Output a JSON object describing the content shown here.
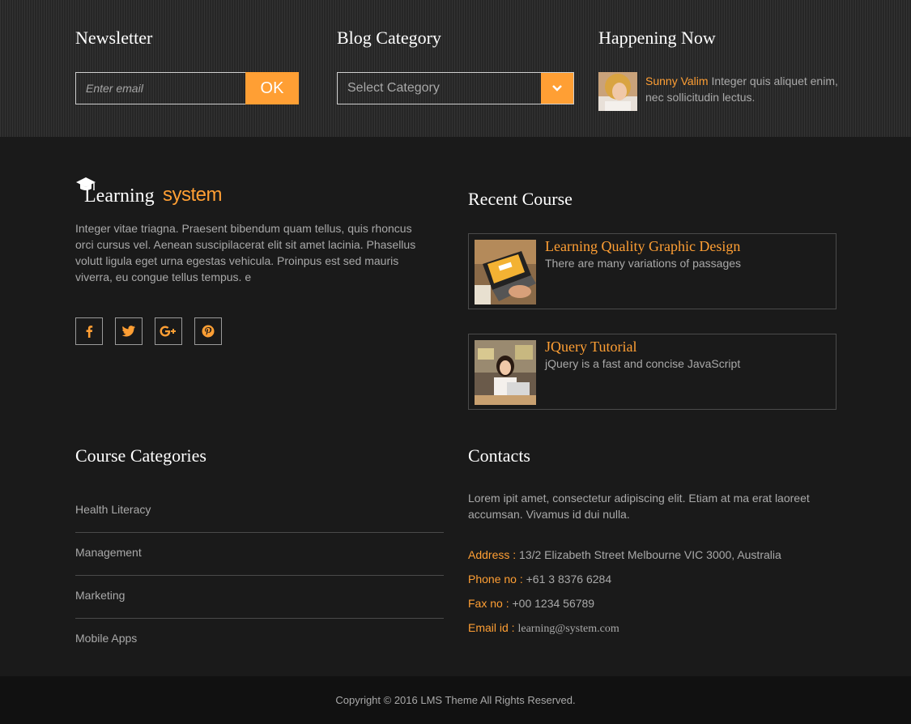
{
  "newsletter": {
    "heading": "Newsletter",
    "email_placeholder": "Enter email",
    "button_label": "OK"
  },
  "blog_category": {
    "heading": "Blog Category",
    "selected": "Select Category"
  },
  "happening_now": {
    "heading": "Happening Now",
    "name": "Sunny Valim",
    "text": " Integer quis aliquet enim, nec sollicitudin lectus."
  },
  "brand": {
    "logo_word1": "Learning",
    "logo_word2": "system",
    "about": "Integer vitae triagna. Praesent bibendum quam tellus, quis rhoncus orci cursus vel. Aenean suscipilacerat elit sit amet lacinia. Phasellus volutt ligula eget urna egestas vehicula. Proinpus est sed mauris viverra, eu congue tellus tempus. e"
  },
  "social": [
    "facebook-icon",
    "twitter-icon",
    "google-plus-icon",
    "pinterest-icon"
  ],
  "recent_course": {
    "heading": "Recent Course",
    "items": [
      {
        "title": "Learning Quality Graphic Design",
        "desc": "There are many variations of passages"
      },
      {
        "title": "JQuery Tutorial",
        "desc": "jQuery is a fast and concise JavaScript"
      }
    ]
  },
  "course_categories": {
    "heading": "Course Categories",
    "items": [
      "Health Literacy",
      "Management",
      "Marketing",
      "Mobile Apps"
    ]
  },
  "contacts": {
    "heading": "Contacts",
    "description": "Lorem ipit amet, consectetur adipiscing elit. Etiam at ma erat laoreet accumsan. Vivamus id dui nulla.",
    "address_label": "Address",
    "address": "13/2 Elizabeth Street Melbourne VIC 3000, Australia",
    "phone_label": "Phone no",
    "phone": "+61 3 8376 6284",
    "fax_label": "Fax no",
    "fax": "+00 1234 56789",
    "email_label": "Email id",
    "email": "learning@system.com"
  },
  "footer": {
    "copyright": "Copyright © 2016 LMS Theme All Rights Reserved."
  },
  "colors": {
    "accent": "#ff9f34",
    "background": "#1a1a1a",
    "top_strip": "#2a2a2a",
    "bottom_bar": "#111111"
  }
}
